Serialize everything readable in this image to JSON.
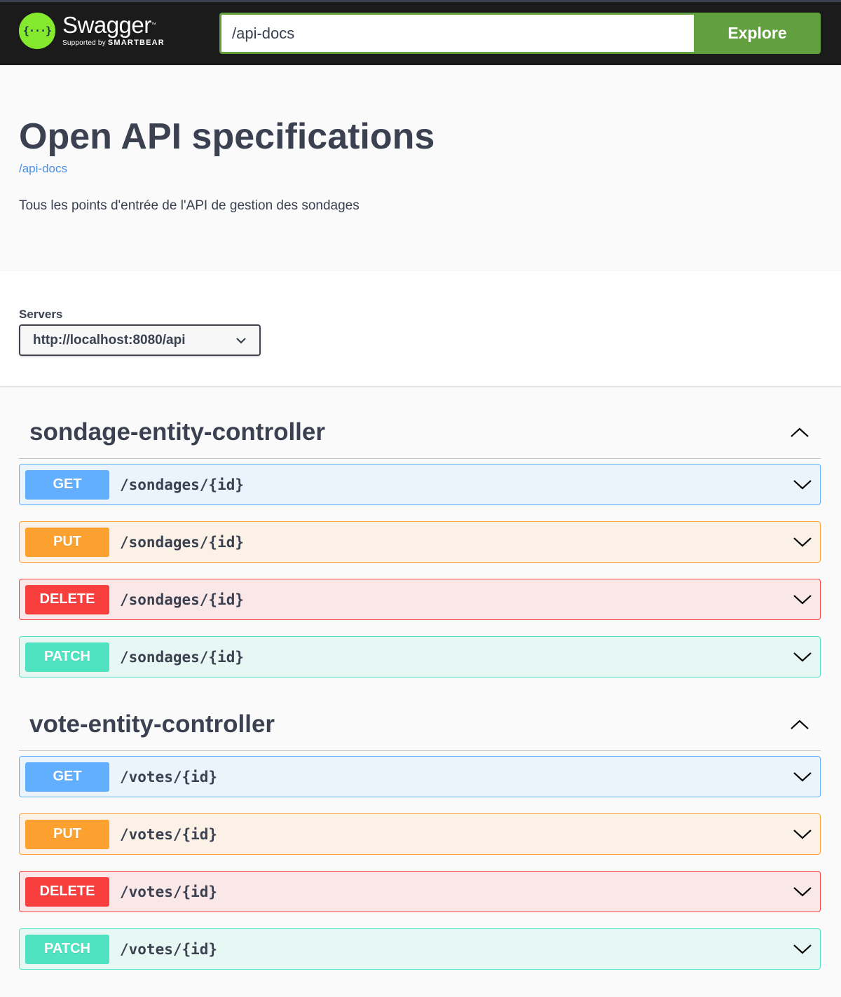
{
  "topbar": {
    "logo_name": "Swagger",
    "logo_tm": "™",
    "logo_supported_by": "Supported by",
    "logo_brand": "SMARTBEAR",
    "logo_icon": "swagger-braces-icon",
    "url_value": "/api-docs",
    "explore_label": "Explore",
    "accent_color": "#62a03f"
  },
  "info": {
    "title": "Open API specifications",
    "url": "/api-docs",
    "description": "Tous les points d'entrée de l'API de gestion des sondages"
  },
  "servers": {
    "label": "Servers",
    "selected": "http://localhost:8080/api"
  },
  "tags": [
    {
      "name": "sondage-entity-controller",
      "expanded": true,
      "operations": [
        {
          "method": "GET",
          "path": "/sondages/{id}"
        },
        {
          "method": "PUT",
          "path": "/sondages/{id}"
        },
        {
          "method": "DELETE",
          "path": "/sondages/{id}"
        },
        {
          "method": "PATCH",
          "path": "/sondages/{id}"
        }
      ]
    },
    {
      "name": "vote-entity-controller",
      "expanded": true,
      "operations": [
        {
          "method": "GET",
          "path": "/votes/{id}"
        },
        {
          "method": "PUT",
          "path": "/votes/{id}"
        },
        {
          "method": "DELETE",
          "path": "/votes/{id}"
        },
        {
          "method": "PATCH",
          "path": "/votes/{id}"
        }
      ]
    }
  ],
  "colors": {
    "get": "#61affe",
    "put": "#fca130",
    "delete": "#f93e3e",
    "patch": "#50e3c2"
  }
}
